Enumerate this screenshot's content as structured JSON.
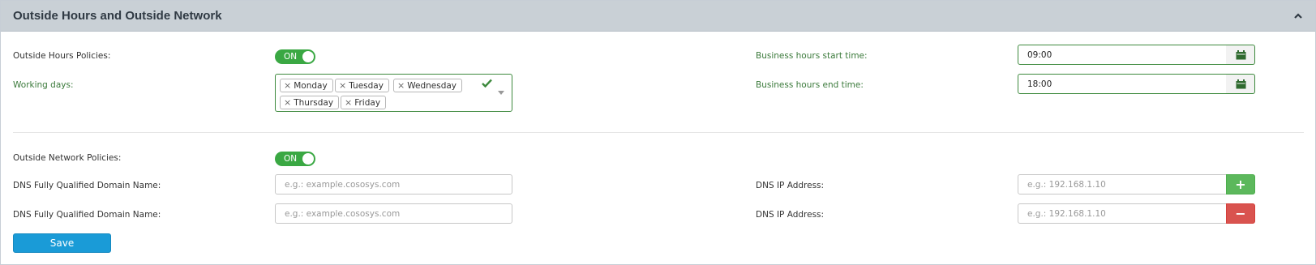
{
  "panel": {
    "title": "Outside Hours and Outside Network",
    "collapse_icon": "chevron-up-icon"
  },
  "outside_hours": {
    "label": "Outside Hours Policies:",
    "toggle": "ON"
  },
  "working_days": {
    "label": "Working days:",
    "selected": [
      "Monday",
      "Tuesday",
      "Wednesday",
      "Thursday",
      "Friday"
    ],
    "remove_glyph": "×",
    "valid_icon": "check-icon",
    "dropdown_icon": "caret-down-icon"
  },
  "business_hours": {
    "start_label": "Business hours start time:",
    "start_value": "09:00",
    "end_label": "Business hours end time:",
    "end_value": "18:00",
    "picker_icon": "calendar-icon"
  },
  "outside_network": {
    "label": "Outside Network Policies:",
    "toggle": "ON"
  },
  "dns_rows": [
    {
      "fqdn_label": "DNS Fully Qualified Domain Name:",
      "fqdn_placeholder": "e.g.: example.cososys.com",
      "ip_label": "DNS IP Address:",
      "ip_placeholder": "e.g.: 192.168.1.10",
      "action": "+"
    },
    {
      "fqdn_label": "DNS Fully Qualified Domain Name:",
      "fqdn_placeholder": "e.g.: example.cososys.com",
      "ip_label": "DNS IP Address:",
      "ip_placeholder": "e.g.: 192.168.1.10",
      "action": "−"
    }
  ],
  "save_label": "Save",
  "colors": {
    "header_bg": "#c9d0d6",
    "toggle_on": "#3aa843",
    "accent_green": "#3e8a3e",
    "add": "#5cb85c",
    "remove": "#d9534f",
    "save": "#1a9bd7"
  }
}
